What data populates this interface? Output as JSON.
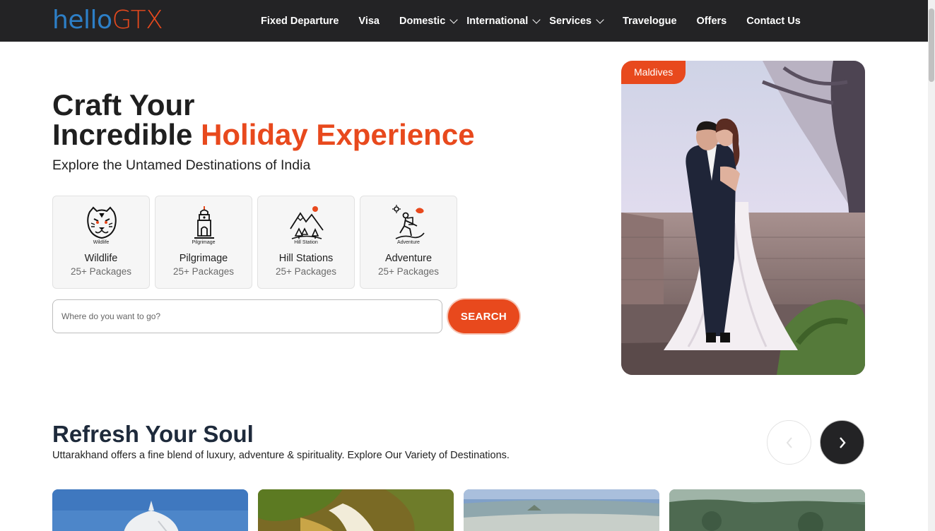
{
  "header": {
    "logo_part1": "hello",
    "logo_part2": "GTX",
    "nav": [
      {
        "label": "Fixed Departure",
        "dropdown": false
      },
      {
        "label": "Visa",
        "dropdown": false
      },
      {
        "label": "Domestic",
        "dropdown": true
      },
      {
        "label": "International",
        "dropdown": true
      },
      {
        "label": "Services",
        "dropdown": true
      },
      {
        "label": "Travelogue",
        "dropdown": false
      },
      {
        "label": "Offers",
        "dropdown": false
      },
      {
        "label": "Contact Us",
        "dropdown": false
      }
    ]
  },
  "hero": {
    "title_line1": "Craft Your",
    "title_line2_plain": "Incredible ",
    "title_line2_accent": "Holiday Experience",
    "subtitle": "Explore the Untamed Destinations of India",
    "categories": [
      {
        "icon": "tiger-icon",
        "caption": "Wildlife",
        "name": "Wildlife",
        "packages": "25+ Packages"
      },
      {
        "icon": "temple-icon",
        "caption": "Pilgrimage",
        "name": "Pilgrimage",
        "packages": "25+ Packages"
      },
      {
        "icon": "mountain-icon",
        "caption": "Hill Station",
        "name": "Hill Stations",
        "packages": "25+ Packages"
      },
      {
        "icon": "hiker-icon",
        "caption": "Adventure",
        "name": "Adventure",
        "packages": "25+ Packages"
      }
    ],
    "search_placeholder": "Where do you want to go?",
    "search_button": "SEARCH",
    "photo_badge": "Maldives"
  },
  "section": {
    "title": "Refresh Your Soul",
    "subtitle": "Uttarakhand offers a fine blend of luxury, adventure & spirituality. Explore Our Variety of Destinations."
  },
  "colors": {
    "accent": "#e8491d",
    "logo_blue": "#2d7fc7",
    "header_bg": "#232325",
    "section_title": "#1e2a3b"
  }
}
